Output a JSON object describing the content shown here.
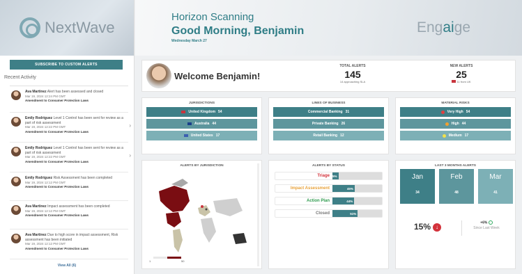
{
  "brand": {
    "name": "NextWave",
    "product_pre": "Eng",
    "product_mid": "ai",
    "product_post": "ge"
  },
  "header": {
    "title": "Horizon Scanning",
    "greeting": "Good Morning, Benjamin",
    "date": "Wednesday March 27"
  },
  "sidebar": {
    "subscribe_label": "SUBSCRIBE TO CUSTOM ALERTS",
    "recent_title": "Recent Activity",
    "view_all": "View All (6)",
    "activities": [
      {
        "name": "Ava Martinez",
        "text": "Alert has been assessed and closed",
        "time": "Mar 19, 2024 12:24 PM GMT",
        "tag": "Amendment to Consumer Protection Laws"
      },
      {
        "name": "Emily Rodriguez",
        "text": "Level 1 Control has been sent for review as a part of risk assessment",
        "time": "Mar 19, 2024 12:22 PM GMT",
        "tag": "Amendment to Consumer Protection Laws"
      },
      {
        "name": "Emily Rodriguez",
        "text": "Level 1 Control has been sent for review as a part of risk assessment",
        "time": "Mar 19, 2024 12:22 PM GMT",
        "tag": "Amendment to Consumer Protection Laws"
      },
      {
        "name": "Emily Rodriguez",
        "text": "Risk Assessment has been completed",
        "time": "Mar 19, 2024 12:12 PM GMT",
        "tag": "Amendment to Consumer Protection Laws"
      },
      {
        "name": "Ava Martinez",
        "text": "Impact assessment has been completed",
        "time": "Mar 19, 2024 12:12 PM GMT",
        "tag": "Amendment to Consumer Protection Laws"
      },
      {
        "name": "Ava Martinez",
        "text": "Due to high score in impact assessment, Risk assessment has been initiated",
        "time": "Mar 19, 2024 12:12 PM GMT",
        "tag": "Amendment to Consumer Protection Laws"
      }
    ]
  },
  "welcome": {
    "text": "Welcome Benjamin!"
  },
  "kpis": {
    "total": {
      "label": "TOTAL ALERTS",
      "value": "145",
      "sub": "14 approaching SLA"
    },
    "new": {
      "label": "NEW ALERTS",
      "value": "25",
      "sub": "11 from UK"
    }
  },
  "jurisdictions": {
    "title": "JURISDICTIONS",
    "items": [
      {
        "label": "United Kingdom",
        "count": "54"
      },
      {
        "label": "Australia",
        "count": "44"
      },
      {
        "label": "United States",
        "count": "17"
      }
    ]
  },
  "lob": {
    "title": "LINES OF BUSINESS",
    "items": [
      {
        "label": "Commercial Banking",
        "count": "31"
      },
      {
        "label": "Private Banking",
        "count": "26"
      },
      {
        "label": "Retail Banking",
        "count": "12"
      }
    ]
  },
  "risks": {
    "title": "MATERIAL RISKS",
    "items": [
      {
        "label": "Very High",
        "count": "54",
        "color": "#e04040"
      },
      {
        "label": "High",
        "count": "44",
        "color": "#f0a030"
      },
      {
        "label": "Medium",
        "count": "17",
        "color": "#f2e14a"
      }
    ]
  },
  "map": {
    "title": "ALERTS BY JURISDICTION",
    "legend_min": "1",
    "legend_max": "50"
  },
  "status": {
    "title": "ALERTS BY STATUS",
    "items": [
      {
        "label": "Triage",
        "pct": "5%",
        "value": 5,
        "color": "#d3323b"
      },
      {
        "label": "Impact Assessment",
        "pct": "45%",
        "value": 45,
        "color": "#e8a23a"
      },
      {
        "label": "Action Plan",
        "pct": "44%",
        "value": 44,
        "color": "#2e9a4e"
      },
      {
        "label": "Closed",
        "pct": "51%",
        "value": 51,
        "color": "#777777"
      }
    ]
  },
  "months": {
    "title": "LAST 3 MONTHS ALERTS",
    "items": [
      {
        "label": "Jan",
        "count": "34"
      },
      {
        "label": "Feb",
        "count": "48"
      },
      {
        "label": "Mar",
        "count": "41"
      }
    ],
    "change_pct": "15%",
    "wow": "+6%",
    "since": "Since Last Week"
  }
}
